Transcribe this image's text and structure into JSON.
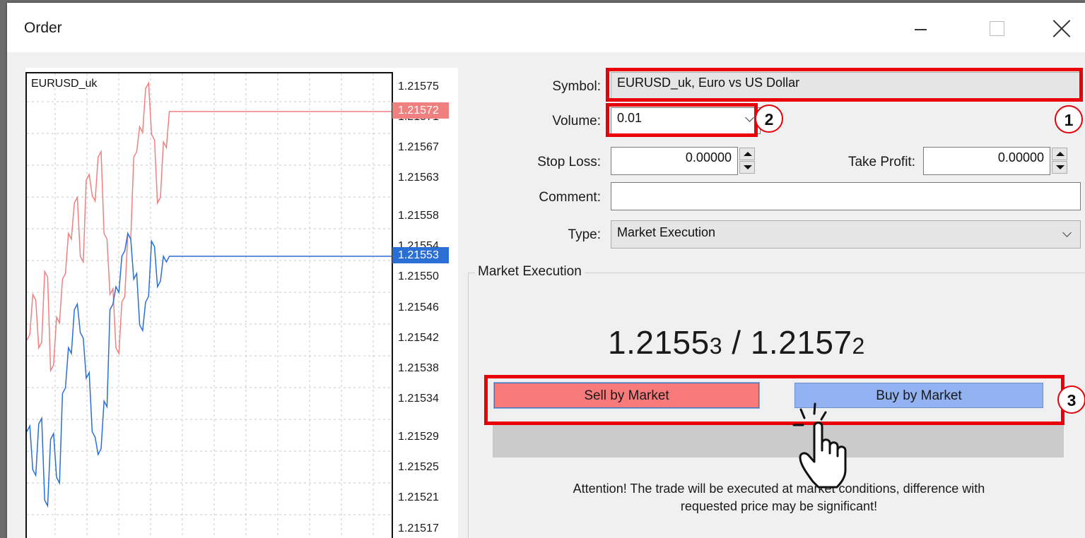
{
  "window": {
    "title": "Order"
  },
  "chart": {
    "symbol": "EURUSD_uk",
    "ask_price": "1.21572",
    "bid_price": "1.21553",
    "ask_color": "#f08080",
    "bid_color": "#2a6fd6",
    "axis_labels": [
      "1.21575",
      "1.21571",
      "1.21567",
      "1.21563",
      "1.21558",
      "1.21554",
      "1.21550",
      "1.21546",
      "1.21542",
      "1.21538",
      "1.21534",
      "1.21529",
      "1.21525",
      "1.21521",
      "1.21517"
    ],
    "ask_series": [
      1.21542,
      1.21548,
      1.21541,
      1.21551,
      1.21538,
      1.21545,
      1.2155,
      1.21556,
      1.2156,
      1.21553,
      1.21563,
      1.21561,
      1.21566,
      1.21556,
      1.21548,
      1.21541,
      1.21547,
      1.21556,
      1.21566,
      1.2157,
      1.21575,
      1.21569,
      1.2156,
      1.21568,
      1.21572,
      1.21572
    ],
    "bid_series": [
      1.2153,
      1.21525,
      1.21531,
      1.21521,
      1.21529,
      1.21524,
      1.21535,
      1.21541,
      1.21546,
      1.21543,
      1.21537,
      1.2153,
      1.21527,
      1.21534,
      1.21546,
      1.21549,
      1.21553,
      1.21556,
      1.2155,
      1.21544,
      1.21547,
      1.21555,
      1.21549,
      1.21553,
      1.21553,
      1.21553
    ]
  },
  "form": {
    "symbol_label": "Symbol:",
    "symbol_value": "EURUSD_uk, Euro vs US Dollar",
    "volume_label": "Volume:",
    "volume_value": "0.01",
    "stop_loss_label": "Stop Loss:",
    "stop_loss_value": "0.00000",
    "take_profit_label": "Take Profit:",
    "take_profit_value": "0.00000",
    "comment_label": "Comment:",
    "comment_value": "",
    "type_label": "Type:",
    "type_value": "Market Execution"
  },
  "market": {
    "group_title": "Market Execution",
    "bid_main": "1.2155",
    "bid_small": "3",
    "separator": " / ",
    "ask_main": "1.2157",
    "ask_small": "2",
    "sell_label": "Sell by Market",
    "buy_label": "Buy by Market",
    "attention_line1": "Attention! The trade will be executed at market conditions, difference with",
    "attention_line2": "requested price may be significant!"
  },
  "annotations": {
    "step1": "1",
    "step2": "2",
    "step3": "3",
    "highlight_color": "#e8000a"
  }
}
